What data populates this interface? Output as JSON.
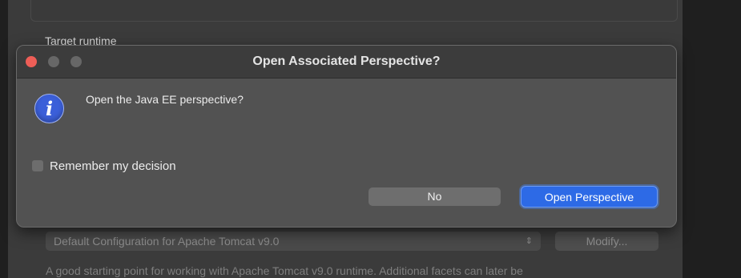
{
  "background": {
    "section_label": "Target runtime",
    "configuration_select": {
      "value": "Default Configuration for Apache Tomcat v9.0"
    },
    "modify_label": "Modify...",
    "description": "A good starting point for working with Apache Tomcat v9.0 runtime. Additional facets can later be"
  },
  "dialog": {
    "title": "Open Associated Perspective?",
    "message": "Open the Java EE perspective?",
    "remember_label": "Remember my decision",
    "remember_checked": false,
    "no_label": "No",
    "open_label": "Open Perspective",
    "icon": "info-icon"
  },
  "colors": {
    "primary_button": "#2d6ae6",
    "close_button": "#ee5e57",
    "info_icon": "#3b5fd9"
  }
}
